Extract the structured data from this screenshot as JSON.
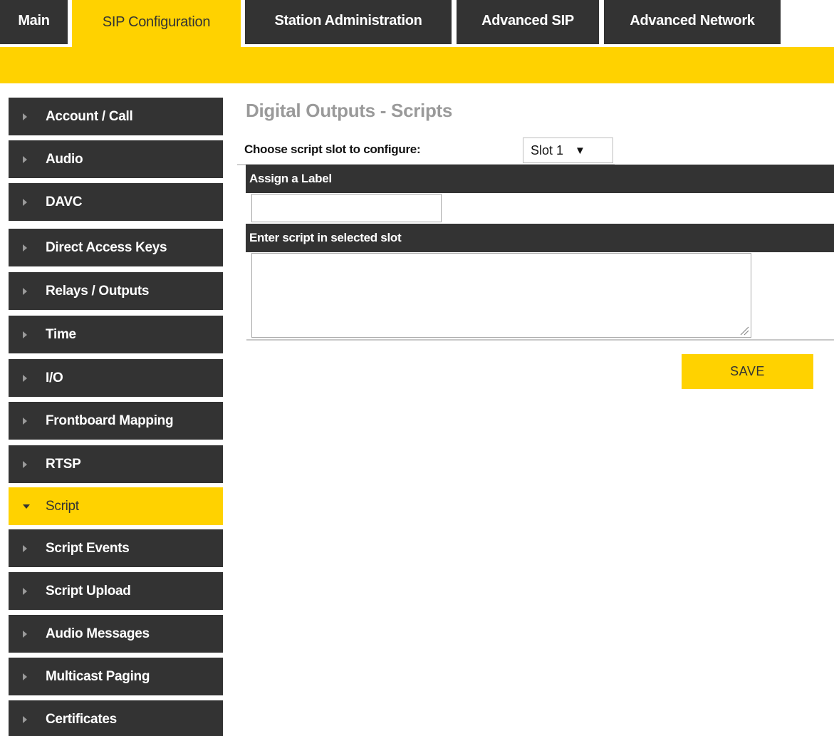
{
  "tabs": [
    {
      "label": "Main",
      "active": false
    },
    {
      "label": "SIP Configuration",
      "active": true
    },
    {
      "label": "Station Administration",
      "active": false
    },
    {
      "label": "Advanced SIP",
      "active": false
    },
    {
      "label": "Advanced Network",
      "active": false
    }
  ],
  "sidebar": {
    "items": [
      {
        "label": "Account / Call"
      },
      {
        "label": "Audio"
      },
      {
        "label": "DAVC"
      },
      {
        "label": "Direct Access Keys"
      },
      {
        "label": "Relays / Outputs"
      },
      {
        "label": "Time"
      },
      {
        "label": "I/O"
      },
      {
        "label": "Frontboard Mapping"
      },
      {
        "label": "RTSP"
      },
      {
        "label": "Script",
        "active": true
      },
      {
        "label": "Script Events"
      },
      {
        "label": "Script Upload"
      },
      {
        "label": "Audio Messages"
      },
      {
        "label": "Multicast Paging"
      },
      {
        "label": "Certificates"
      }
    ]
  },
  "main": {
    "title": "Digital Outputs - Scripts",
    "slot_label": "Choose script slot to configure:",
    "slot_selected": "Slot 1",
    "slot_caret": "▼",
    "assign_label_header": "Assign a Label",
    "label_value": "",
    "script_header": "Enter script in selected slot",
    "script_value": "",
    "save_label": "SAVE"
  },
  "colors": {
    "accent": "#ffd200",
    "dark": "#333333",
    "muted_title": "#9a9a9a"
  }
}
